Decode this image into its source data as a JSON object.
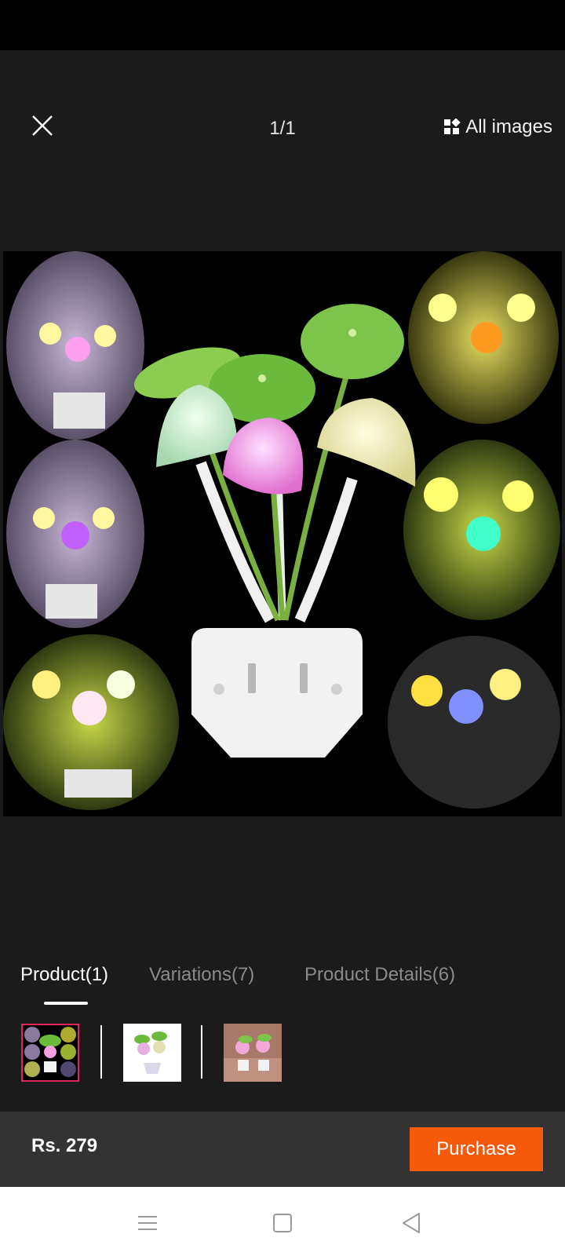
{
  "viewer": {
    "counter": "1/1",
    "all_images_label": "All images"
  },
  "tabs": [
    {
      "label": "Product(1)",
      "active": true
    },
    {
      "label": "Variations(7)",
      "active": false
    },
    {
      "label": "Product Details(6)",
      "active": false
    }
  ],
  "thumbnails": [
    {
      "name": "collage",
      "selected": true
    },
    {
      "name": "white-lamp",
      "selected": false
    },
    {
      "name": "pink-lamps-room",
      "selected": false
    }
  ],
  "purchase": {
    "price": "Rs. 279",
    "button_label": "Purchase",
    "button_color": "#f55a0a"
  },
  "icons": [
    "close-icon",
    "grid-icon",
    "menu-icon",
    "home-icon",
    "back-icon"
  ]
}
